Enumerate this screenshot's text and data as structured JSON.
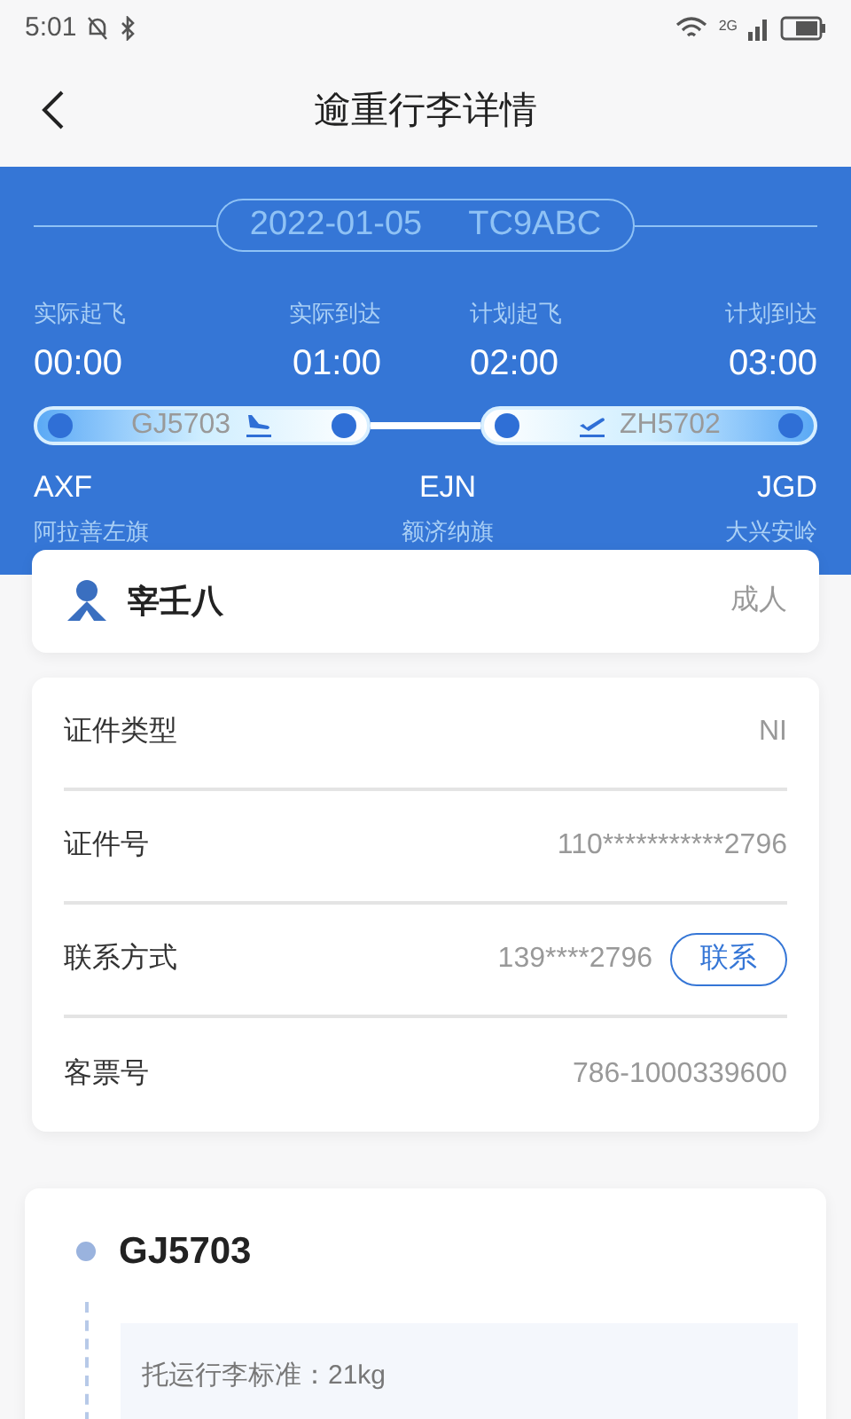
{
  "status_bar": {
    "time": "5:01",
    "network": "2G"
  },
  "header": {
    "title": "逾重行李详情"
  },
  "trip": {
    "date": "2022-01-05",
    "code": "TC9ABC",
    "times": [
      {
        "label": "实际起飞",
        "value": "00:00"
      },
      {
        "label": "实际到达",
        "value": "01:00"
      },
      {
        "label": "计划起飞",
        "value": "02:00"
      },
      {
        "label": "计划到达",
        "value": "03:00"
      }
    ],
    "segments": [
      {
        "flight": "GJ5703",
        "kind": "landing"
      },
      {
        "flight": "ZH5702",
        "kind": "takeoff"
      }
    ],
    "airports": [
      {
        "code": "AXF",
        "name": "阿拉善左旗"
      },
      {
        "code": "EJN",
        "name": "额济纳旗"
      },
      {
        "code": "JGD",
        "name": "大兴安岭"
      }
    ]
  },
  "passenger": {
    "name": "宰壬八",
    "type": "成人"
  },
  "details": [
    {
      "label": "证件类型",
      "value": "NI"
    },
    {
      "label": "证件号",
      "value": "110***********2796"
    },
    {
      "label": "联系方式",
      "value": "139****2796",
      "action": "联系"
    },
    {
      "label": "客票号",
      "value": "786-1000339600"
    }
  ],
  "flight_card": {
    "flight": "GJ5703",
    "baggage_standard": "托运行李标准：21kg"
  }
}
